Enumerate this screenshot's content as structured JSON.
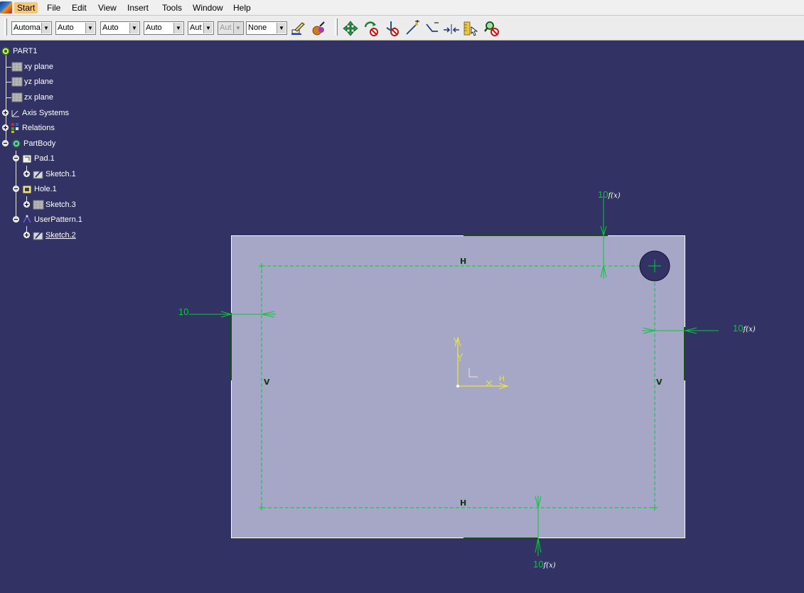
{
  "menu": {
    "items": [
      "Start",
      "File",
      "Edit",
      "View",
      "Insert",
      "Tools",
      "Window",
      "Help"
    ],
    "active": "Start"
  },
  "toolbar": {
    "combos": [
      {
        "value": "Automa",
        "disabled": false
      },
      {
        "value": "Auto",
        "disabled": false
      },
      {
        "value": "Auto",
        "disabled": false
      },
      {
        "value": "Auto",
        "disabled": false
      },
      {
        "value": "Aut",
        "disabled": false
      },
      {
        "value": "Aut",
        "disabled": true
      },
      {
        "value": "None",
        "disabled": false
      }
    ],
    "icons": [
      "painter-icon",
      "color-picker-icon",
      "four-way-arrows-icon",
      "rotate-no-icon",
      "anchor-no-icon",
      "line-point-icon",
      "corner-icon",
      "arrows-inward-icon",
      "ruler-icon",
      "magnifier-no-icon"
    ]
  },
  "tree": {
    "root": "PART1",
    "items": [
      {
        "label": "xy plane",
        "icon": "plane-icon"
      },
      {
        "label": "yz plane",
        "icon": "plane-icon"
      },
      {
        "label": "zx plane",
        "icon": "plane-icon"
      },
      {
        "label": "Axis Systems",
        "icon": "axis-system-icon"
      },
      {
        "label": "Relations",
        "icon": "relations-icon"
      },
      {
        "label": "PartBody",
        "icon": "partbody-icon"
      },
      {
        "label": "Pad.1",
        "icon": "pad-icon"
      },
      {
        "label": "Sketch.1",
        "icon": "sketch-icon"
      },
      {
        "label": "Hole.1",
        "icon": "hole-icon"
      },
      {
        "label": "Sketch.3",
        "icon": "sketch-plane-icon"
      },
      {
        "label": "UserPattern.1",
        "icon": "user-pattern-icon"
      },
      {
        "label": "Sketch.2",
        "icon": "sketch-icon",
        "selected": true
      }
    ]
  },
  "sketch": {
    "dimensions": {
      "top": "10",
      "left": "10",
      "right": "10",
      "bottom": "10",
      "formula_symbol": "f(x)"
    },
    "constraints": {
      "horizontal": "H",
      "vertical": "V"
    },
    "axes": {
      "x": "H",
      "y": "V"
    }
  },
  "colors": {
    "background": "#323264",
    "plate": "#a6a6c6",
    "dimension": "#00cc33",
    "construction": "#00cc33",
    "axis": "#e8e840"
  }
}
